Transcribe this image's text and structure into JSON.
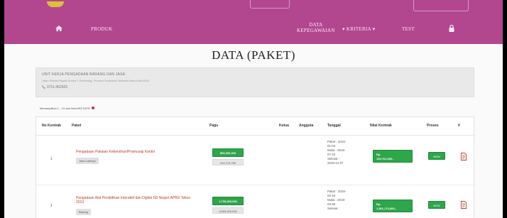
{
  "nav": {
    "home_icon": "home-icon",
    "produk": "PRODUK",
    "data_line1": "DATA",
    "data_line2": "KEPEGAWAIAN",
    "kriteria": "▾ KRITERIA ▾",
    "test": "TEST",
    "lock_icon": "lock-icon"
  },
  "page_title": "DATA (PAKET)",
  "info": {
    "org": "UNIT KERJA PENGADAAN BARANG DAN JASA",
    "address": "Jalan Slamet Riyadi Nomor 1 Rembang, Provinsi Surakarta Sebelah Utara Kota 5010",
    "phone": "0711-452925"
  },
  "showing": "Menampilkan 1 - 10 dari total 693 DATA",
  "table": {
    "headers": {
      "no": "No Kontrak",
      "paket": "Paket",
      "pagu": "Pagu",
      "ketua": "Ketua",
      "anggota": "Anggota",
      "tanggal": "Tanggal",
      "nilai": "Nilai Kontrak",
      "proses": "Proses",
      "hash": "#"
    },
    "rows": [
      {
        "no": "1",
        "paket": "Pengadaan Pakaian Kebersihan/Pramusaji Kantor",
        "kategori": "Jasa Lainnya",
        "pagu": "500,000,000",
        "pagu_sub": "410,719,750",
        "tanggal": [
          "Paket : 2019-",
          "01-04",
          "Mulai : 2019-",
          "07-22",
          "Selesai :",
          "2019-12-07"
        ],
        "nilai_line1": "Rp.",
        "nilai_line2": "130,761,600,-",
        "proses": "NEW"
      },
      {
        "no": "1",
        "paket": "Pengadaan Alat Pendidikan Interaktif dan Digital SD Negeri APBD Tahun 2019",
        "kategori": "Barang",
        "pagu": "1,700,000,000",
        "pagu_sub": "3,600,400,000",
        "tanggal": [
          "Paket : 2019-",
          "02-10",
          "Mulai : 2019-",
          "03-26",
          "Selesai :"
        ],
        "nilai_line1": "Rp.",
        "nilai_line2": "1,361,173,300,-",
        "proses": "NEW"
      }
    ]
  },
  "colors": {
    "header": "#b2478f",
    "success": "#2ea64a",
    "link": "#c0392b"
  }
}
